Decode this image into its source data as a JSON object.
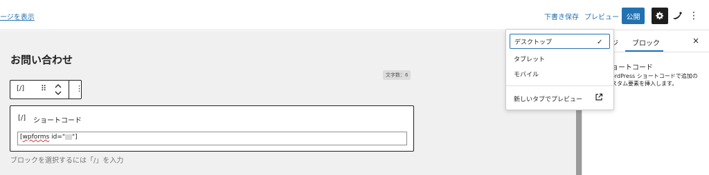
{
  "topbar": {
    "view_page_link": "ージを表示",
    "save_draft": "下書き保存",
    "preview": "プレビュー",
    "publish": "公開"
  },
  "editor": {
    "post_title": "お問い合わせ",
    "char_count": "文字数：6",
    "block_toolbar_icon": "[/]",
    "shortcode_block": {
      "icon": "[/]",
      "label": "ショートコード",
      "value_prefix": "[",
      "value_word": "wpforms",
      "value_mid": " id=\"",
      "value_suffix": "\"]"
    },
    "appender_hint": "ブロックを選択するには「/」を入力"
  },
  "sidebar": {
    "tab_page": "ジ",
    "tab_block": "ブロック",
    "close_glyph": "×",
    "block_title": "ョートコード",
    "block_description": "ordPress ショートコードで追加の\nスタム要素を挿入します。"
  },
  "preview_menu": {
    "items": [
      {
        "label": "デスクトップ",
        "selected": true
      },
      {
        "label": "タブレット",
        "selected": false
      },
      {
        "label": "モバイル",
        "selected": false
      }
    ],
    "check_glyph": "✓",
    "new_tab_preview": "新しいタブでプレビュー"
  },
  "colors": {
    "accent": "#2271b1",
    "dark": "#1e1e1e",
    "canvas_bg": "#f0f0f0"
  },
  "icons": [
    "gear-icon",
    "jetpack-icon",
    "more-vertical-icon",
    "drag-handle-icon",
    "chevron-up-icon",
    "chevron-down-icon",
    "close-icon",
    "checkmark-icon",
    "external-link-icon",
    "shortcode-icon"
  ]
}
